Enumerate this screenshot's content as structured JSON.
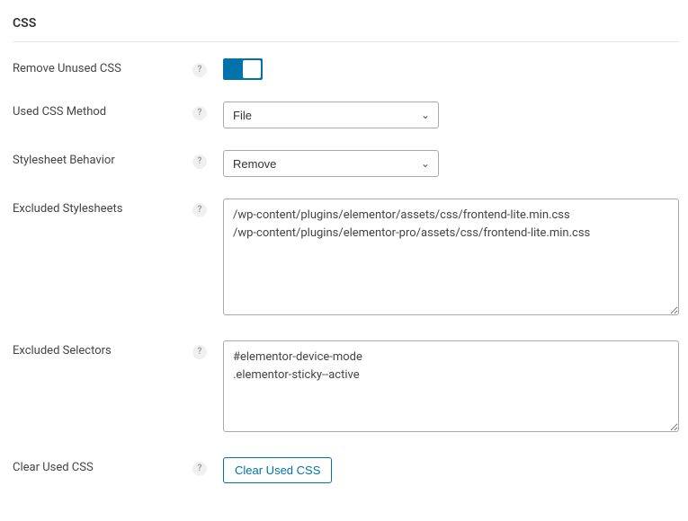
{
  "section": {
    "title": "CSS"
  },
  "fields": {
    "remove_unused_css": {
      "label": "Remove Unused CSS",
      "enabled": true
    },
    "used_css_method": {
      "label": "Used CSS Method",
      "value": "File"
    },
    "stylesheet_behavior": {
      "label": "Stylesheet Behavior",
      "value": "Remove"
    },
    "excluded_stylesheets": {
      "label": "Excluded Stylesheets",
      "value": "/wp-content/plugins/elementor/assets/css/frontend-lite.min.css\n/wp-content/plugins/elementor-pro/assets/css/frontend-lite.min.css"
    },
    "excluded_selectors": {
      "label": "Excluded Selectors",
      "value": "#elementor-device-mode\n.elementor-sticky--active"
    },
    "clear_used_css": {
      "label": "Clear Used CSS",
      "button": "Clear Used CSS"
    }
  },
  "help_glyph": "?"
}
